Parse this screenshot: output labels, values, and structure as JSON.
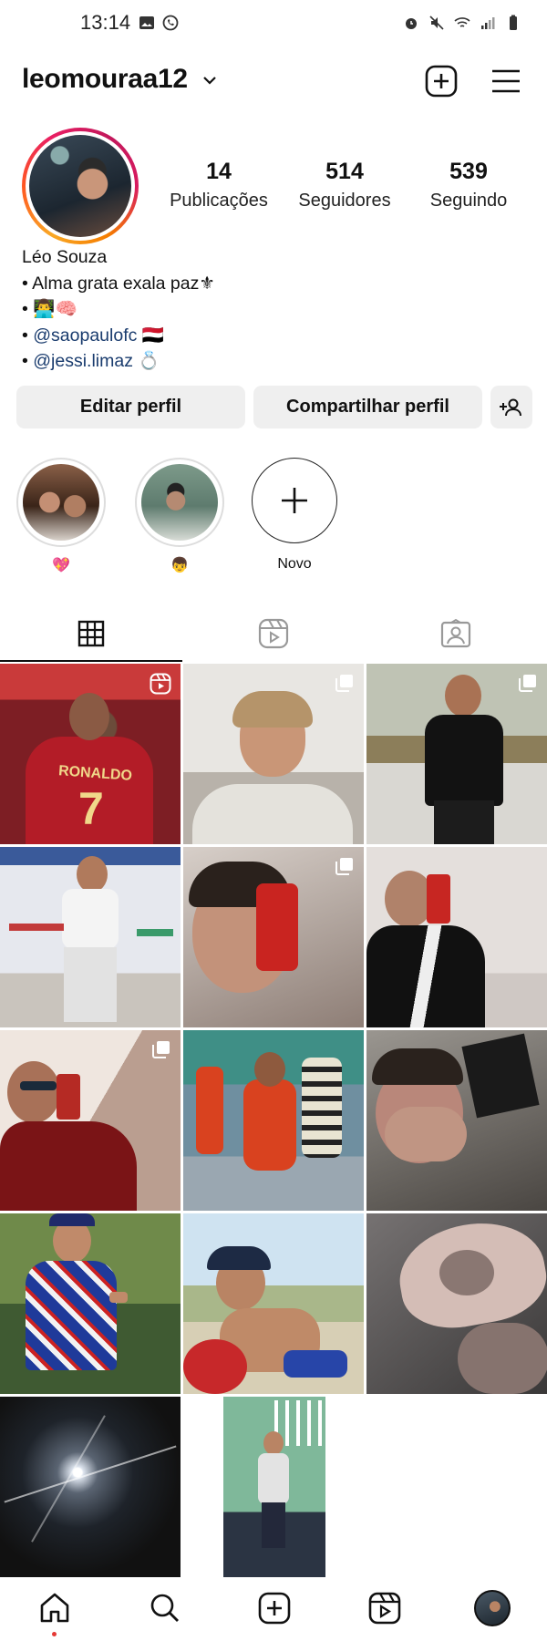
{
  "status_bar": {
    "time": "13:14",
    "left_icons": [
      "image-icon",
      "whatsapp-icon"
    ],
    "right_icons": [
      "alarm-icon",
      "mute-icon",
      "wifi-icon",
      "signal-icon",
      "battery-icon"
    ]
  },
  "header": {
    "username": "leomouraa12",
    "icons": [
      "chevron-down-icon",
      "new-post-icon",
      "menu-icon"
    ]
  },
  "stats": [
    {
      "number": "14",
      "label": "Publicações"
    },
    {
      "number": "514",
      "label": "Seguidores"
    },
    {
      "number": "539",
      "label": "Seguindo"
    }
  ],
  "bio": {
    "name": "Léo Souza",
    "line1": "• Alma grata exala paz⚜",
    "line2": "• 👨‍💻🧠",
    "line3_bullet": "• ",
    "line3_link": "@saopaulofc",
    "line3_suffix": " 🇾🇪",
    "line4_bullet": "• ",
    "line4_link": "@jessi.limaz",
    "line4_suffix": " 💍"
  },
  "buttons": {
    "edit_profile": "Editar perfil",
    "share_profile": "Compartilhar perfil",
    "discover_icon": "add-person-icon"
  },
  "highlights": [
    {
      "label": "💖",
      "icon": "couple-photo"
    },
    {
      "label": "👦",
      "icon": "selfie-photo"
    },
    {
      "label": "Novo",
      "icon": "plus-icon"
    }
  ],
  "tabs": [
    "grid-icon",
    "reels-icon",
    "tagged-icon"
  ],
  "posts": [
    {
      "type": "reel",
      "desc": "ronaldo-7"
    },
    {
      "type": "carousel",
      "desc": "selfie"
    },
    {
      "type": "carousel",
      "desc": "standing-black-shirt"
    },
    {
      "type": "photo",
      "desc": "classroom"
    },
    {
      "type": "carousel",
      "desc": "mirror-selfie"
    },
    {
      "type": "photo",
      "desc": "mirror-selfie-jacket"
    },
    {
      "type": "carousel",
      "desc": "sunglasses-selfie"
    },
    {
      "type": "photo",
      "desc": "futsal-team"
    },
    {
      "type": "photo",
      "desc": "covering-face"
    },
    {
      "type": "photo",
      "desc": "blue-shirt"
    },
    {
      "type": "photo",
      "desc": "beach-chair"
    },
    {
      "type": "photo",
      "desc": "hand-heart"
    },
    {
      "type": "photo",
      "desc": "flash-mirror"
    },
    {
      "type": "photo",
      "desc": "standing-wall"
    }
  ],
  "bottom_nav": [
    "home-icon",
    "search-icon",
    "create-icon",
    "reels-icon",
    "profile-avatar"
  ],
  "colors": {
    "accent_link": "#1a3c6e",
    "button_bg": "#efefef",
    "story_ring": "#e91e63"
  }
}
